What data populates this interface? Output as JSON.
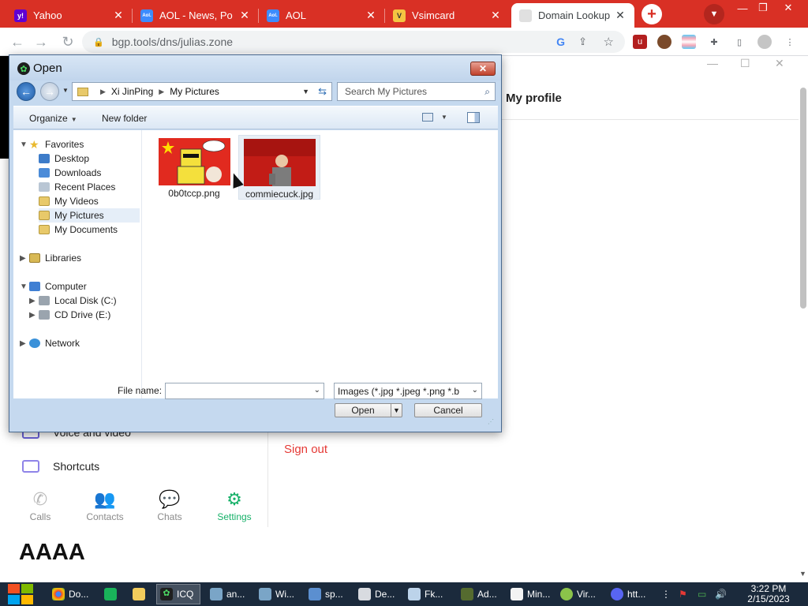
{
  "browser": {
    "tabs": [
      {
        "title": "Yahoo",
        "favicon_text": "y!",
        "favicon_color": "#6001d2"
      },
      {
        "title": "AOL - News, Po",
        "favicon_text": "Aol.",
        "favicon_color": "#3d8bfd"
      },
      {
        "title": "AOL",
        "favicon_text": "Aol.",
        "favicon_color": "#3d8bfd"
      },
      {
        "title": "Vsimcard",
        "favicon_text": "V",
        "favicon_color": "#f4c542"
      },
      {
        "title": "Domain Lookup",
        "favicon_text": "",
        "favicon_color": "#cccccc"
      }
    ],
    "url": "bgp.tools/dns/julias.zone",
    "accent_color": "#d93025"
  },
  "icq": {
    "profile_title": "My profile",
    "menu_voice": "Voice and video",
    "menu_shortcuts": "Shortcuts",
    "sign_out": "Sign out",
    "nav": [
      {
        "label": "Calls",
        "icon": "phone-icon"
      },
      {
        "label": "Contacts",
        "icon": "contacts-icon"
      },
      {
        "label": "Chats",
        "icon": "chat-icon"
      },
      {
        "label": "Settings",
        "icon": "gear-icon"
      }
    ],
    "bottom_text": "AAAA",
    "accent_color": "#17b169"
  },
  "dialog": {
    "title": "Open",
    "breadcrumb": [
      "Xi JinPing",
      "My Pictures"
    ],
    "search_placeholder": "Search My Pictures",
    "organize": "Organize",
    "new_folder": "New folder",
    "tree": {
      "favorites": "Favorites",
      "desktop": "Desktop",
      "downloads": "Downloads",
      "recent": "Recent Places",
      "videos": "My Videos",
      "pictures": "My Pictures",
      "documents": "My Documents",
      "libraries": "Libraries",
      "computer": "Computer",
      "local_disk": "Local Disk (C:)",
      "cd_drive": "CD Drive (E:)",
      "network": "Network"
    },
    "files": [
      {
        "name": "0b0tccp.png"
      },
      {
        "name": "commiecuck.jpg"
      }
    ],
    "file_name_label": "File name:",
    "file_name_value": "",
    "file_type": "Images (*.jpg *.jpeg *.png *.b",
    "open_button": "Open",
    "cancel_button": "Cancel"
  },
  "taskbar": {
    "items": [
      {
        "label": "Do...",
        "icon": "chrome-icon"
      },
      {
        "label": "",
        "icon": "green-app-icon"
      },
      {
        "label": "",
        "icon": "folder-icon"
      },
      {
        "label": "ICQ",
        "icon": "icq-icon"
      },
      {
        "label": "an...",
        "icon": "people-icon"
      },
      {
        "label": "Wi...",
        "icon": "people-icon"
      },
      {
        "label": "sp...",
        "icon": "app-icon"
      },
      {
        "label": "De...",
        "icon": "app-icon"
      },
      {
        "label": "Fk...",
        "icon": "app-icon"
      },
      {
        "label": "Ad...",
        "icon": "app-icon"
      },
      {
        "label": "Min...",
        "icon": "notepad-icon"
      },
      {
        "label": "Vir...",
        "icon": "app-icon"
      },
      {
        "label": "htt...",
        "icon": "discord-icon"
      }
    ],
    "time": "3:22 PM",
    "date": "2/15/2023"
  }
}
